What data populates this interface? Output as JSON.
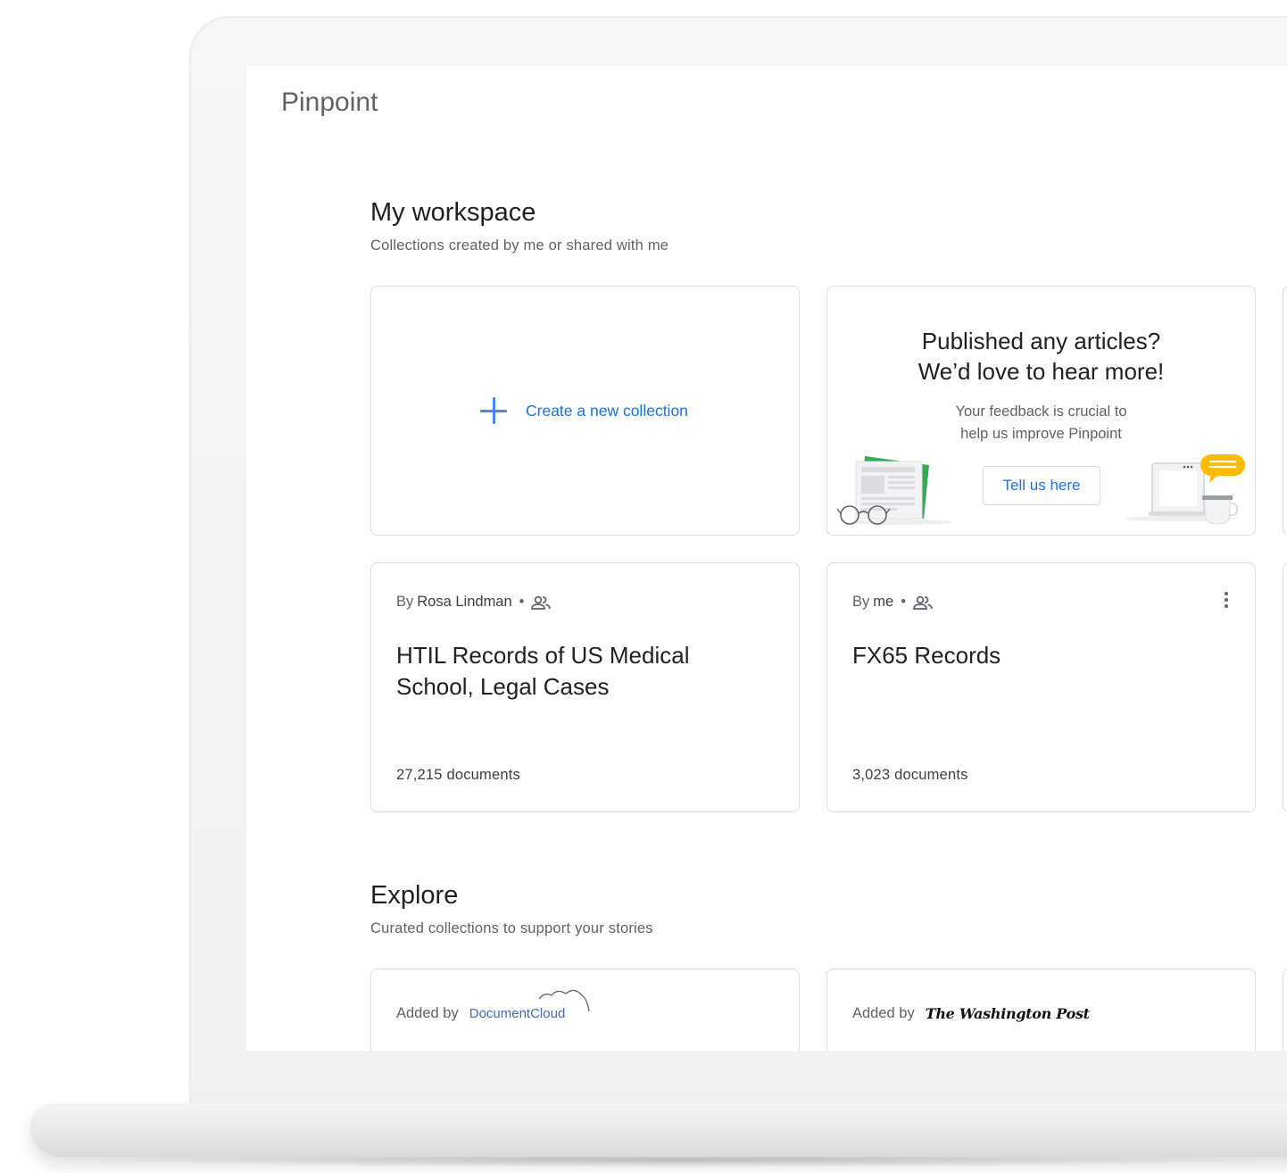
{
  "app": {
    "title": "Pinpoint"
  },
  "workspace": {
    "title": "My workspace",
    "subtitle": "Collections created by me or shared with me",
    "create_label": "Create a new collection",
    "feedback": {
      "title_line1": "Published any articles?",
      "title_line2": "We’d love to hear more!",
      "text_line1": "Your feedback is crucial to",
      "text_line2": "help us improve Pinpoint",
      "button": "Tell us here"
    },
    "collections": [
      {
        "by_prefix": "By",
        "owner": "Rosa Lindman",
        "separator": "•",
        "title": "HTIL Records of US Medical School, Legal Cases",
        "documents": "27,215 documents"
      },
      {
        "by_prefix": "By",
        "owner": "me",
        "separator": "•",
        "title": "FX65 Records",
        "documents": "3,023 documents"
      }
    ]
  },
  "explore": {
    "title": "Explore",
    "subtitle": "Curated collections to support your stories",
    "cards": [
      {
        "added_by": "Added by",
        "source": "DocumentCloud"
      },
      {
        "added_by": "Added by",
        "source": "The Washington Post"
      }
    ]
  },
  "colors": {
    "accent": "#1a73e8",
    "plus": "#4285f4",
    "text": "#202124",
    "muted": "#5f6368",
    "border": "#dadce0"
  }
}
